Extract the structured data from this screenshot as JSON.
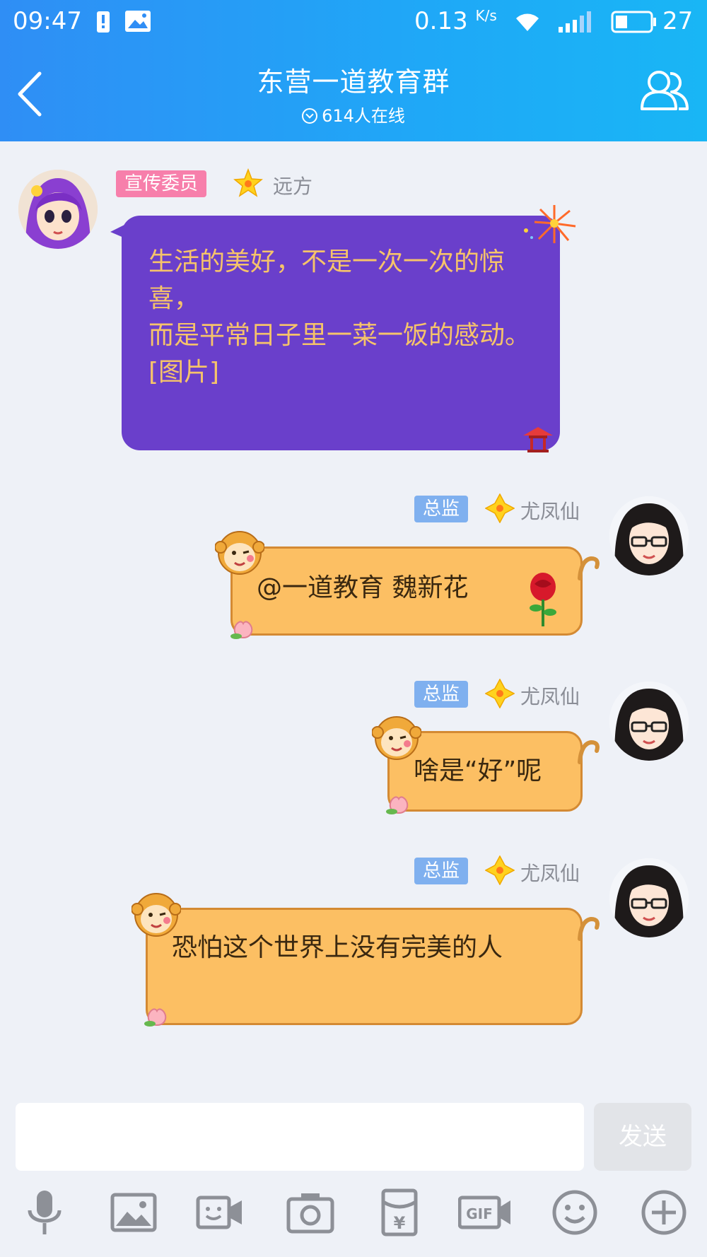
{
  "status_bar": {
    "time": "09:47",
    "net_speed": "0.13",
    "net_unit": "K/s",
    "battery_level": "27"
  },
  "nav": {
    "title": "东营一道教育群",
    "online": "614人在线"
  },
  "messages": [
    {
      "badge": "宣传委员",
      "sender": "远方",
      "text": "生活的美好，不是一次一次的惊喜，\n而是平常日子里一菜一饭的感动。[图片]"
    },
    {
      "badge": "总监",
      "sender": "尤凤仙",
      "text": "@一道教育 魏新花"
    },
    {
      "badge": "总监",
      "sender": "尤凤仙",
      "text": "啥是“好”呢"
    },
    {
      "badge": "总监",
      "sender": "尤凤仙",
      "text": "恐怕这个世界上没有完美的人"
    }
  ],
  "input": {
    "value": "",
    "send_label": "发送"
  },
  "toolbar": [
    "mic-icon",
    "image-icon",
    "video-call-icon",
    "camera-icon",
    "red-packet-icon",
    "gif-icon",
    "emoji-icon",
    "plus-icon"
  ],
  "colors": {
    "header": "#1fa8f7",
    "purple_bubble": "#6a3fcb",
    "purple_text": "#f6c36a",
    "orange_bubble": "#fcbf63",
    "badge_pink": "#f77fab",
    "badge_blue": "#7fb0ef"
  }
}
